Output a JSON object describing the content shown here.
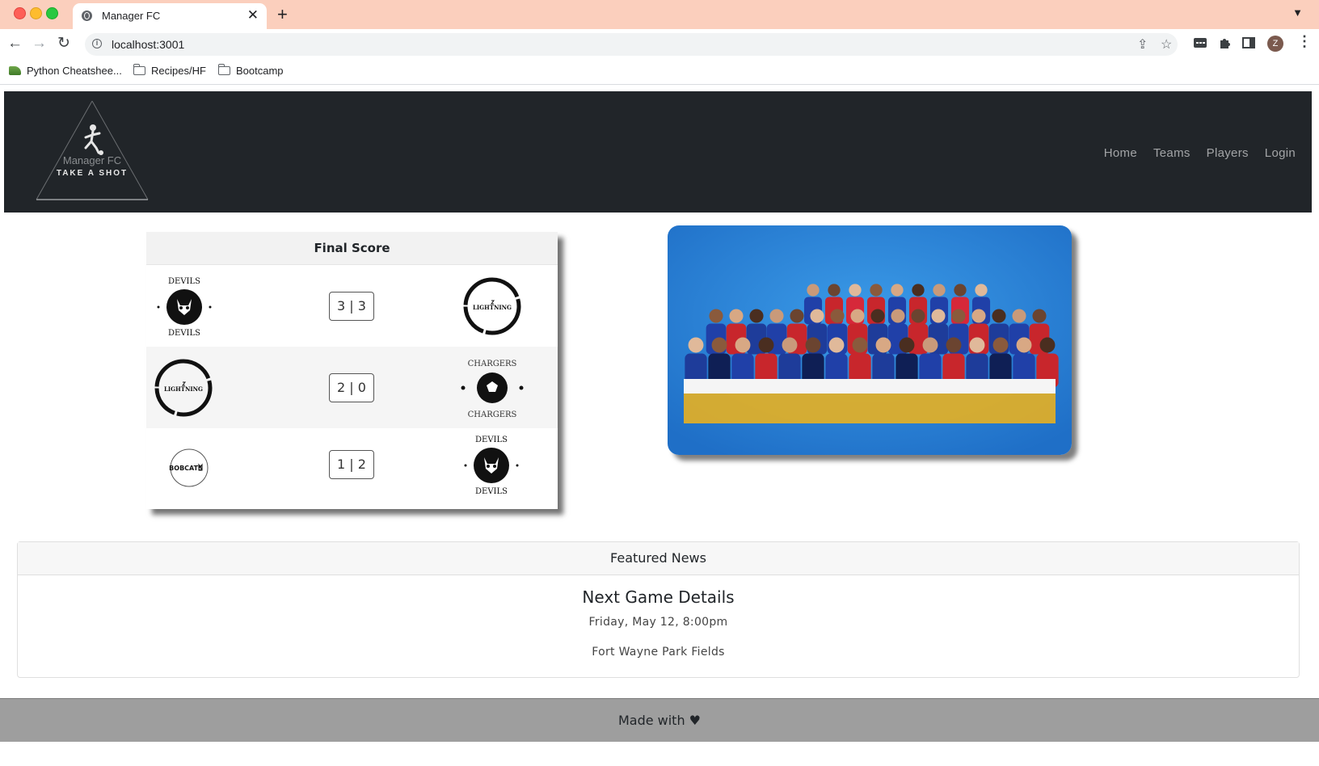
{
  "browser": {
    "tab_title": "Manager FC",
    "url": "localhost:3001",
    "profile_initial": "Z",
    "bookmarks": [
      "Python Cheatshee...",
      "Recipes/HF",
      "Bootcamp"
    ]
  },
  "site": {
    "logo_line1": "Manager FC",
    "logo_line2": "TAKE A SHOT",
    "nav": [
      "Home",
      "Teams",
      "Players",
      "Login"
    ]
  },
  "scores": {
    "title": "Final Score",
    "rows": [
      {
        "home": "DEVILS",
        "away": "LIGHTNING",
        "score": "3 | 3"
      },
      {
        "home": "LIGHTNING",
        "away": "CHARGERS",
        "score": "2 | 0"
      },
      {
        "home": "BOBCATS",
        "away": "DEVILS",
        "score": "1 | 2"
      }
    ]
  },
  "news": {
    "header": "Featured News",
    "title": "Next Game Details",
    "date": "Friday, May 12, 8:00pm",
    "location": "Fort Wayne Park Fields"
  },
  "footer": {
    "text": "Made with ♥"
  }
}
